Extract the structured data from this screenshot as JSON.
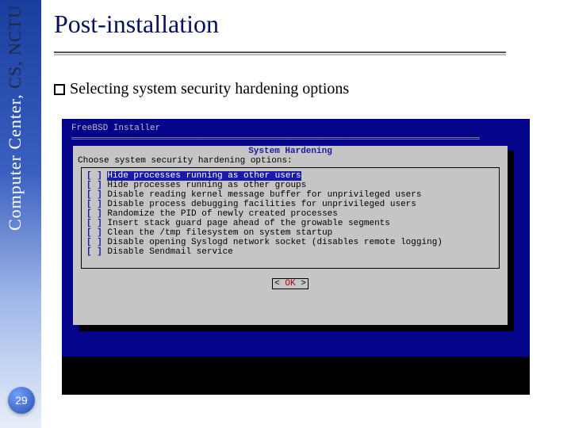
{
  "sidebar": {
    "org_light": "Computer Center, ",
    "org_dark": "CS, NCTU"
  },
  "page_number": "29",
  "title": "Post-installation",
  "subtitle": "Selecting system security hardening options",
  "installer": {
    "header": "FreeBSD Installer",
    "dialog_title": "System Hardening",
    "prompt": "Choose system security hardening options:",
    "options": [
      {
        "label": "Hide processes running as other users",
        "highlighted": true
      },
      {
        "label": "Hide processes running as other groups",
        "highlighted": false
      },
      {
        "label": "Disable reading kernel message buffer for unprivileged users",
        "highlighted": false
      },
      {
        "label": "Disable process debugging facilities for unprivileged users",
        "highlighted": false
      },
      {
        "label": "Randomize the PID of newly created processes",
        "highlighted": false
      },
      {
        "label": "Insert stack guard page ahead of the growable segments",
        "highlighted": false
      },
      {
        "label": "Clean the /tmp filesystem on system startup",
        "highlighted": false
      },
      {
        "label": "Disable opening Syslogd network socket (disables remote logging)",
        "highlighted": false
      },
      {
        "label": "Disable Sendmail service",
        "highlighted": false
      }
    ],
    "ok_label": "OK"
  }
}
